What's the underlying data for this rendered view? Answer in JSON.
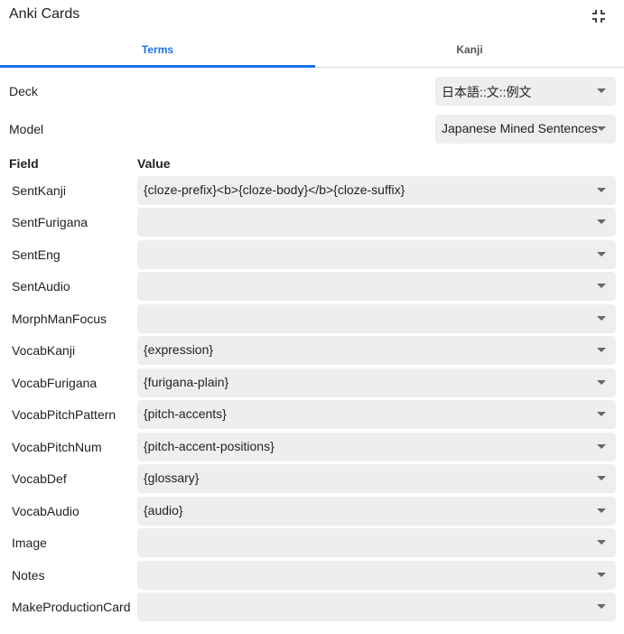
{
  "window": {
    "title": "Anki Cards"
  },
  "tabs": [
    {
      "label": "Terms",
      "active": true
    },
    {
      "label": "Kanji",
      "active": false
    }
  ],
  "deck": {
    "label": "Deck",
    "value": "日本語::文::例文"
  },
  "model": {
    "label": "Model",
    "value": "Japanese Mined Sentences"
  },
  "columns": {
    "field": "Field",
    "value": "Value"
  },
  "fields": [
    {
      "name": "SentKanji",
      "value": "{cloze-prefix}<b>{cloze-body}</b>{cloze-suffix}"
    },
    {
      "name": "SentFurigana",
      "value": ""
    },
    {
      "name": "SentEng",
      "value": ""
    },
    {
      "name": "SentAudio",
      "value": ""
    },
    {
      "name": "MorphManFocus",
      "value": ""
    },
    {
      "name": "VocabKanji",
      "value": "{expression}"
    },
    {
      "name": "VocabFurigana",
      "value": "{furigana-plain}"
    },
    {
      "name": "VocabPitchPattern",
      "value": "{pitch-accents}"
    },
    {
      "name": "VocabPitchNum",
      "value": "{pitch-accent-positions}"
    },
    {
      "name": "VocabDef",
      "value": "{glossary}"
    },
    {
      "name": "VocabAudio",
      "value": "{audio}"
    },
    {
      "name": "Image",
      "value": ""
    },
    {
      "name": "Notes",
      "value": ""
    },
    {
      "name": "MakeProductionCard",
      "value": ""
    }
  ],
  "colors": {
    "accent": "#1a73e8",
    "select_bg": "#eeeeee"
  },
  "icons": {
    "collapse": "collapse-icon",
    "dropdown": "chevron-down-icon"
  }
}
